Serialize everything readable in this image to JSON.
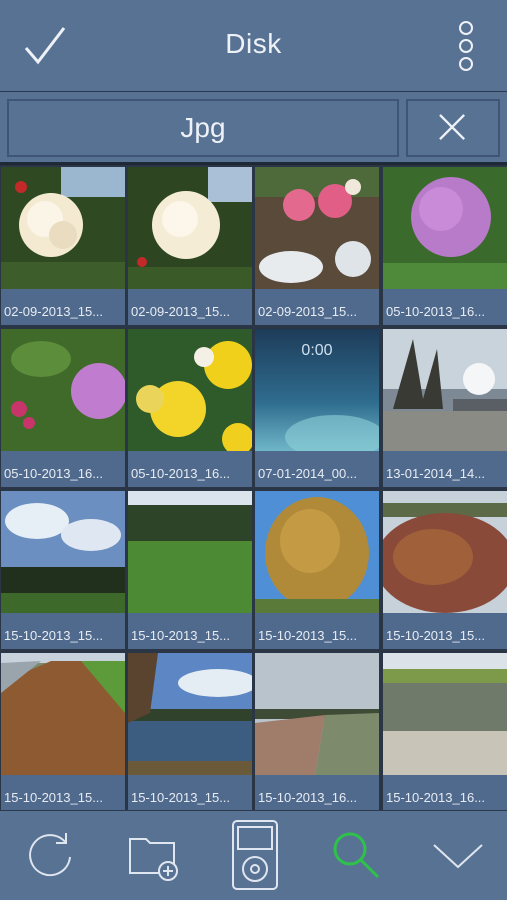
{
  "header": {
    "title": "Disk",
    "icons": [
      "check-icon",
      "more-vertical-icon"
    ]
  },
  "filter": {
    "value": "Jpg",
    "clear_icon": "close-icon"
  },
  "photos": [
    "02-09-2013_15...",
    "02-09-2013_15...",
    "02-09-2013_15...",
    "05-10-2013_16...",
    "05-10-2013_16...",
    "05-10-2013_16...",
    "07-01-2014_00...",
    "13-01-2014_14...",
    "15-10-2013_15...",
    "15-10-2013_15...",
    "15-10-2013_15...",
    "15-10-2013_15...",
    "15-10-2013_15...",
    "15-10-2013_15...",
    "15-10-2013_16...",
    "15-10-2013_16..."
  ],
  "lockscreen_time": "0:00",
  "toolbar": {
    "icons": [
      "refresh-icon",
      "add-folder-icon",
      "ipod-icon",
      "search-icon",
      "chevron-down-icon"
    ],
    "active_color": "#2fc24a"
  },
  "colors": {
    "bar": "#587294",
    "grid_bg": "#2a3646",
    "caption_bg": "#506a8d"
  }
}
